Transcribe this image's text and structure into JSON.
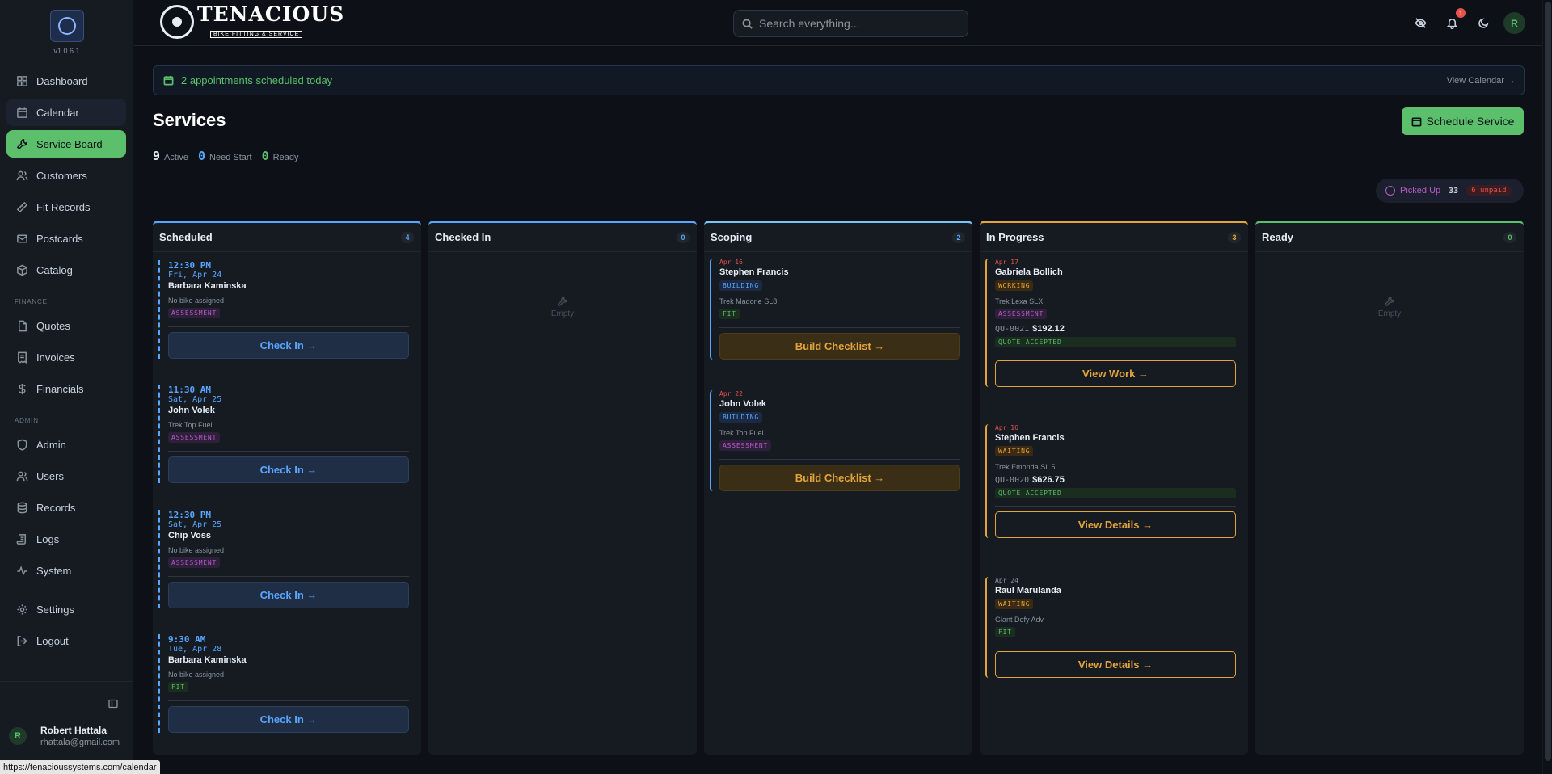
{
  "sidebar": {
    "version": "v1.0.6.1",
    "items": [
      {
        "label": "Dashboard",
        "icon": "dashboard-icon"
      },
      {
        "label": "Calendar",
        "icon": "calendar-icon"
      },
      {
        "label": "Service Board",
        "icon": "wrench-icon"
      },
      {
        "label": "Customers",
        "icon": "users-icon"
      },
      {
        "label": "Fit Records",
        "icon": "ruler-icon"
      },
      {
        "label": "Postcards",
        "icon": "mail-icon"
      },
      {
        "label": "Catalog",
        "icon": "package-icon"
      },
      {
        "label": "Quotes",
        "icon": "file-icon"
      },
      {
        "label": "Invoices",
        "icon": "receipt-icon"
      },
      {
        "label": "Financials",
        "icon": "dollar-icon"
      },
      {
        "label": "Admin",
        "icon": "shield-icon"
      },
      {
        "label": "Users",
        "icon": "users-icon"
      },
      {
        "label": "Records",
        "icon": "database-icon"
      },
      {
        "label": "Logs",
        "icon": "scroll-icon"
      },
      {
        "label": "System",
        "icon": "activity-icon"
      },
      {
        "label": "Settings",
        "icon": "gear-icon"
      },
      {
        "label": "Logout",
        "icon": "logout-icon"
      }
    ],
    "section_finance": "FINANCE",
    "section_admin": "ADMIN",
    "user": {
      "initial": "R",
      "name": "Robert Hattala",
      "email": "rhattala@gmail.com"
    }
  },
  "status_url": "https://tenacioussystems.com/calendar",
  "topbar": {
    "brand": "TENACIOUS",
    "brand_sub": "BIKE FITTING & SERVICE",
    "search_placeholder": "Search everything...",
    "notification_count": "1",
    "avatar_initial": "R"
  },
  "banner": {
    "message": "2 appointments scheduled today",
    "link": "View Calendar →"
  },
  "page": {
    "title": "Services",
    "schedule_button": "Schedule Service",
    "stats": [
      {
        "value": "9",
        "label": "Active",
        "color": "#e6edf3"
      },
      {
        "value": "0",
        "label": "Need Start",
        "color": "#58a6ff"
      },
      {
        "value": "0",
        "label": "Ready",
        "color": "#5cbf6c"
      }
    ],
    "picked_up": {
      "label": "Picked Up",
      "count": "33",
      "unpaid": "6 unpaid"
    }
  },
  "columns": {
    "scheduled": {
      "title": "Scheduled",
      "count": "4",
      "cards": [
        {
          "time": "12:30 PM",
          "date": "Fri, Apr 24",
          "name": "Barbara Kaminska",
          "bike": "No bike assigned",
          "tag": "ASSESSMENT",
          "action": "Check In →"
        },
        {
          "time": "11:30 AM",
          "date": "Sat, Apr 25",
          "name": "John Volek",
          "bike": "Trek Top Fuel",
          "tag": "ASSESSMENT",
          "action": "Check In →"
        },
        {
          "time": "12:30 PM",
          "date": "Sat, Apr 25",
          "name": "Chip Voss",
          "bike": "No bike assigned",
          "tag": "ASSESSMENT",
          "action": "Check In →"
        },
        {
          "time": "9:30 AM",
          "date": "Tue, Apr 28",
          "name": "Barbara Kaminska",
          "bike": "No bike assigned",
          "tag": "FIT",
          "action": "Check In →"
        }
      ]
    },
    "checked_in": {
      "title": "Checked In",
      "count": "0",
      "empty": "Empty"
    },
    "scoping": {
      "title": "Scoping",
      "count": "2",
      "cards": [
        {
          "date": "Apr 16",
          "name": "Stephen Francis",
          "status": "BUILDING",
          "bike": "Trek Madone SL8",
          "tag": "FIT",
          "action": "Build Checklist →"
        },
        {
          "date": "Apr 22",
          "name": "John Volek",
          "status": "BUILDING",
          "bike": "Trek Top Fuel",
          "tag": "ASSESSMENT",
          "action": "Build Checklist →"
        }
      ]
    },
    "in_progress": {
      "title": "In Progress",
      "count": "3",
      "cards": [
        {
          "date": "Apr 17",
          "name": "Gabriela Bollich",
          "status": "WORKING",
          "bike": "Trek Lexa SLX",
          "tag": "ASSESSMENT",
          "quote": "QU-0021",
          "amount": "$192.12",
          "quote_status": "QUOTE ACCEPTED",
          "action": "View Work →"
        },
        {
          "date": "Apr 16",
          "name": "Stephen Francis",
          "status": "WAITING",
          "bike": "Trek Emonda SL 5",
          "quote": "QU-0020",
          "amount": "$626.75",
          "quote_status": "QUOTE ACCEPTED",
          "action": "View Details →"
        },
        {
          "date": "Apr 24",
          "name": "Raul Marulanda",
          "status": "WAITING",
          "bike": "Giant Defy Adv",
          "tag": "FIT",
          "action": "View Details →"
        }
      ]
    },
    "ready": {
      "title": "Ready",
      "count": "0",
      "empty": "Empty"
    }
  },
  "colors": {
    "accent": "#5cbf6c",
    "blue": "#58a6ff",
    "orange": "#e3a43a",
    "purple": "#b55cc8",
    "red": "#e5534b"
  }
}
